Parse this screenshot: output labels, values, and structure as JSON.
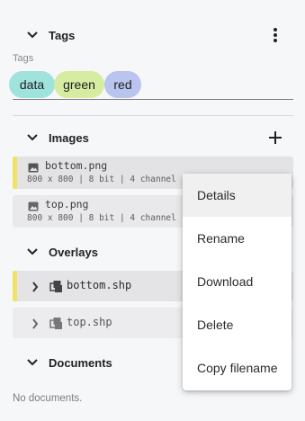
{
  "tags": {
    "title": "Tags",
    "caption": "Tags",
    "items": [
      {
        "label": "data",
        "color": "#a0e3dc"
      },
      {
        "label": "green",
        "color": "#d6eca0"
      },
      {
        "label": "red",
        "color": "#b9c4ef"
      }
    ]
  },
  "images": {
    "title": "Images",
    "items": [
      {
        "name": "bottom.png",
        "meta": "800 x 800 | 8 bit | 4 channel",
        "active": true
      },
      {
        "name": "top.png",
        "meta": "800 x 800 | 8 bit | 4 channel",
        "active": false
      }
    ]
  },
  "overlays": {
    "title": "Overlays",
    "items": [
      {
        "name": "bottom.shp",
        "active": true
      },
      {
        "name": "top.shp",
        "active": false
      }
    ]
  },
  "documents": {
    "title": "Documents",
    "empty_text": "No documents."
  },
  "context_menu": {
    "items": [
      "Details",
      "Rename",
      "Download",
      "Delete",
      "Copy filename"
    ]
  },
  "colors": {
    "accent": "#f0e264"
  }
}
